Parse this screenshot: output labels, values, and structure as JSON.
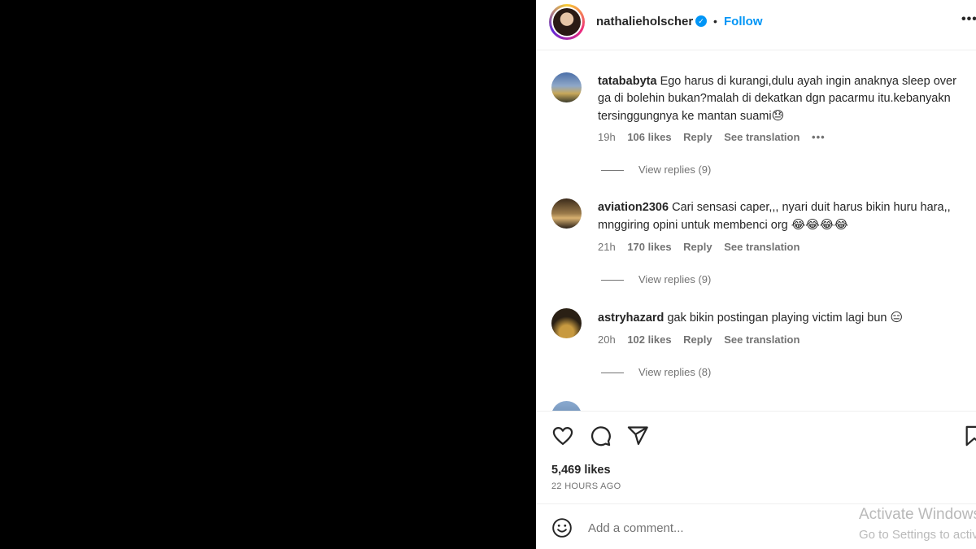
{
  "post": {
    "username": "nathalieholscher",
    "separator": "•",
    "follow_label": "Follow",
    "more_icon": "more-horizontal-icon"
  },
  "comments": [
    {
      "username": "tatababyta",
      "text": "Ego harus di kurangi,dulu ayah ingin anaknya sleep over ga di bolehin bukan?malah di dekatkan dgn pacarmu itu.kebanyakn tersinggungnya ke mantan suami",
      "emoji": "😓",
      "time": "19h",
      "likes": "106 likes",
      "reply_label": "Reply",
      "translation_label": "See translation",
      "view_replies": "View replies (9)"
    },
    {
      "username": "aviation2306",
      "text": "Cari sensasi caper,,, nyari duit harus bikin huru hara,, mnggiring opini untuk membenci org",
      "emoji": "😂😂😂😂",
      "time": "21h",
      "likes": "170 likes",
      "reply_label": "Reply",
      "translation_label": "See translation",
      "view_replies": "View replies (9)"
    },
    {
      "username": "astryhazard",
      "text": "gak bikin postingan playing victim lagi bun",
      "emoji": "😑",
      "time": "20h",
      "likes": "102 likes",
      "reply_label": "Reply",
      "translation_label": "See translation",
      "view_replies": "View replies (8)"
    }
  ],
  "actions": {
    "likes_count": "5,469 likes",
    "timestamp": "22 HOURS AGO"
  },
  "composer": {
    "placeholder": "Add a comment..."
  },
  "watermark": {
    "line1": "Activate Windows",
    "line2": "Go to Settings to activate Windows."
  },
  "colors": {
    "accent": "#0095f6",
    "text": "#262626",
    "muted": "#737373"
  }
}
